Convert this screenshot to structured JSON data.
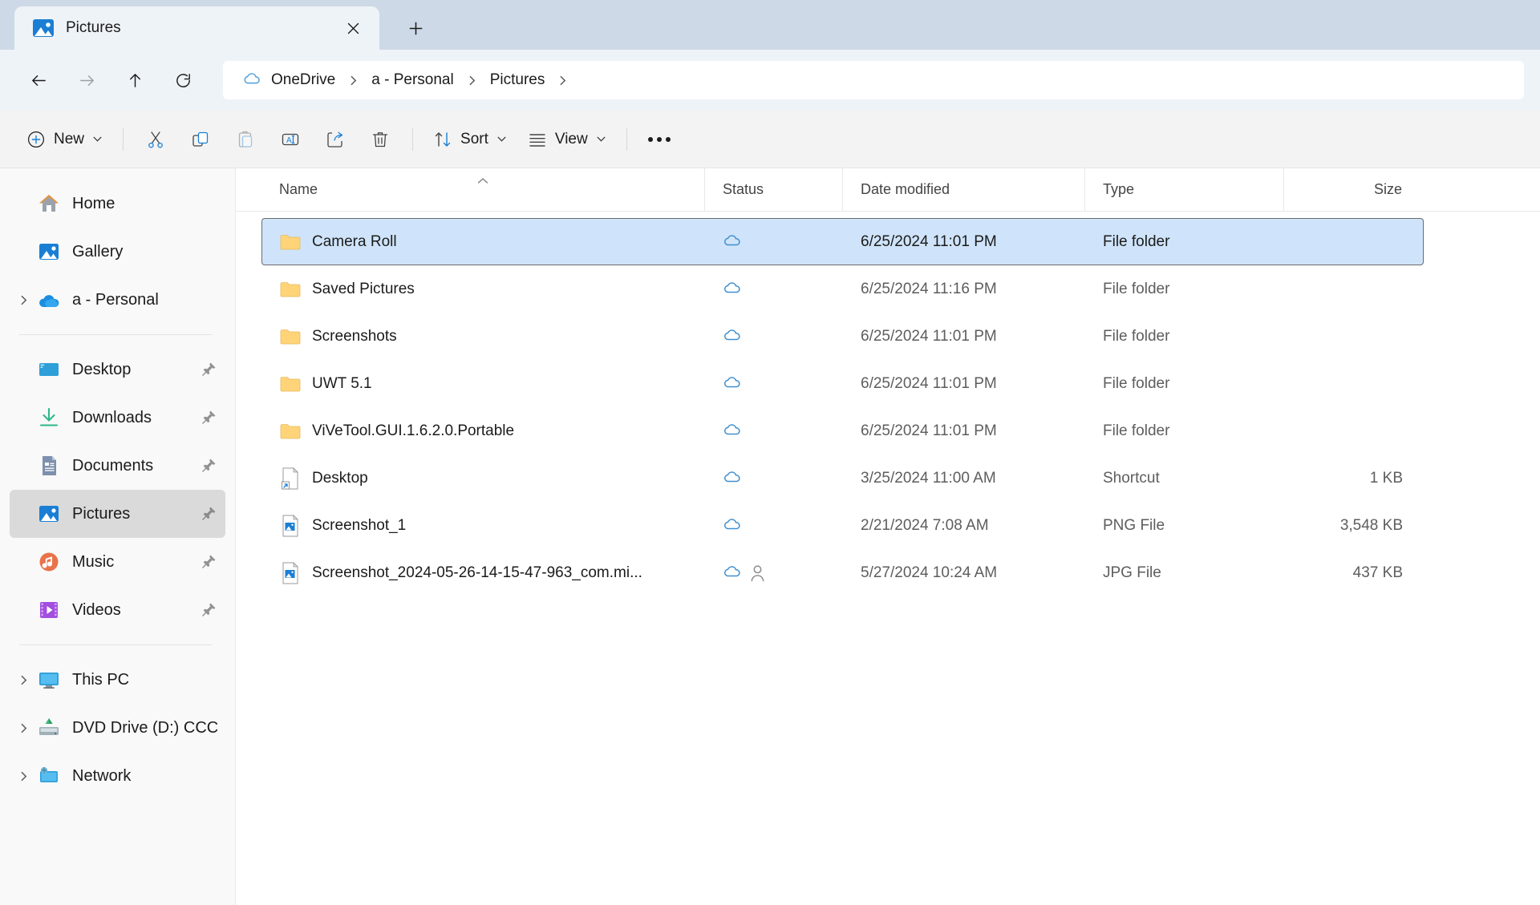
{
  "window": {
    "tab_title": "Pictures",
    "app_icon": "pictures-icon",
    "close_icon": "close-icon",
    "newtab_icon": "plus-icon"
  },
  "address": {
    "back_icon": "back-arrow-icon",
    "forward_icon": "forward-arrow-icon",
    "up_icon": "up-arrow-icon",
    "refresh_icon": "refresh-icon",
    "breadcrumbs": [
      {
        "label": "OneDrive",
        "icon": "onedrive-cloud-icon"
      },
      {
        "label": "a - Personal",
        "icon": ""
      },
      {
        "label": "Pictures",
        "icon": ""
      }
    ]
  },
  "toolbar": {
    "new_label": "New",
    "sort_label": "Sort",
    "view_label": "View",
    "cut_icon": "scissors-icon",
    "copy_icon": "copy-icon",
    "paste_icon": "paste-icon",
    "rename_icon": "rename-icon",
    "share_icon": "share-icon",
    "delete_icon": "trash-icon",
    "more_icon": "ellipsis-icon"
  },
  "sidebar": {
    "groups": [
      {
        "items": [
          {
            "label": "Home",
            "icon": "home-icon",
            "expandable": false,
            "pinned": false,
            "selected": false
          },
          {
            "label": "Gallery",
            "icon": "gallery-icon",
            "expandable": false,
            "pinned": false,
            "selected": false
          },
          {
            "label": "a - Personal",
            "icon": "onedrive-icon",
            "expandable": true,
            "pinned": false,
            "selected": false
          }
        ]
      },
      {
        "items": [
          {
            "label": "Desktop",
            "icon": "desktop-icon",
            "expandable": false,
            "pinned": true,
            "selected": false
          },
          {
            "label": "Downloads",
            "icon": "downloads-icon",
            "expandable": false,
            "pinned": true,
            "selected": false
          },
          {
            "label": "Documents",
            "icon": "documents-icon",
            "expandable": false,
            "pinned": true,
            "selected": false
          },
          {
            "label": "Pictures",
            "icon": "pictures-icon",
            "expandable": false,
            "pinned": true,
            "selected": true
          },
          {
            "label": "Music",
            "icon": "music-icon",
            "expandable": false,
            "pinned": true,
            "selected": false
          },
          {
            "label": "Videos",
            "icon": "videos-icon",
            "expandable": false,
            "pinned": true,
            "selected": false
          }
        ]
      },
      {
        "items": [
          {
            "label": "This PC",
            "icon": "thispc-icon",
            "expandable": true,
            "pinned": false,
            "selected": false
          },
          {
            "label": "DVD Drive (D:) CCC",
            "icon": "dvd-icon",
            "expandable": true,
            "pinned": false,
            "selected": false
          },
          {
            "label": "Network",
            "icon": "network-icon",
            "expandable": true,
            "pinned": false,
            "selected": false
          }
        ]
      }
    ]
  },
  "filelist": {
    "columns": [
      "Name",
      "Status",
      "Date modified",
      "Type",
      "Size"
    ],
    "sorted_column": "Name",
    "sort_direction": "ascending",
    "rows": [
      {
        "name": "Camera Roll",
        "icon": "folder-icon",
        "status": "cloud",
        "date": "6/25/2024 11:01 PM",
        "type": "File folder",
        "size": "",
        "selected": true
      },
      {
        "name": "Saved Pictures",
        "icon": "folder-icon",
        "status": "cloud",
        "date": "6/25/2024 11:16 PM",
        "type": "File folder",
        "size": "",
        "selected": false
      },
      {
        "name": "Screenshots",
        "icon": "folder-icon",
        "status": "cloud",
        "date": "6/25/2024 11:01 PM",
        "type": "File folder",
        "size": "",
        "selected": false
      },
      {
        "name": "UWT 5.1",
        "icon": "folder-icon",
        "status": "cloud",
        "date": "6/25/2024 11:01 PM",
        "type": "File folder",
        "size": "",
        "selected": false
      },
      {
        "name": "ViVeTool.GUI.1.6.2.0.Portable",
        "icon": "folder-icon",
        "status": "cloud",
        "date": "6/25/2024 11:01 PM",
        "type": "File folder",
        "size": "",
        "selected": false
      },
      {
        "name": "Desktop",
        "icon": "shortcut-icon",
        "status": "cloud",
        "date": "3/25/2024 11:00 AM",
        "type": "Shortcut",
        "size": "1 KB",
        "selected": false
      },
      {
        "name": "Screenshot_1",
        "icon": "image-file-icon",
        "status": "cloud",
        "date": "2/21/2024 7:08 AM",
        "type": "PNG File",
        "size": "3,548 KB",
        "selected": false
      },
      {
        "name": "Screenshot_2024-05-26-14-15-47-963_com.mi...",
        "icon": "image-file-icon",
        "status": "cloud-shared",
        "date": "5/27/2024 10:24 AM",
        "type": "JPG File",
        "size": "437 KB",
        "selected": false
      }
    ]
  },
  "colors": {
    "accent": "#0078d4",
    "titlebar_bg": "#cdd9e6",
    "tab_bg": "#eef3f8",
    "selection_bg": "#cfe4fa",
    "sidebar_selected_bg": "#dadada",
    "folder_yellow": "#ffd479"
  }
}
